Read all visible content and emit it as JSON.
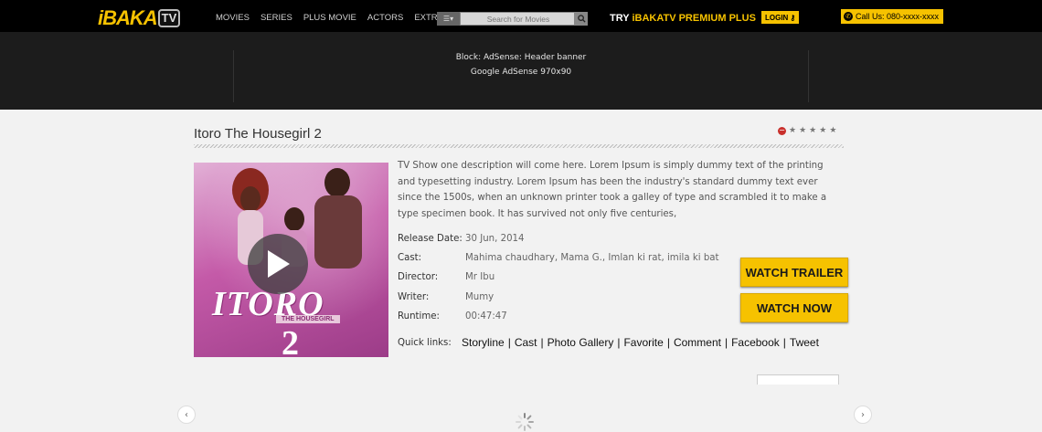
{
  "header": {
    "logo_text": "iBAKA",
    "logo_tv": "TV",
    "nav": [
      "MOVIES",
      "SERIES",
      "PLUS MOVIE",
      "ACTORS",
      "EXTRAS"
    ],
    "search_placeholder": "Search for Movies",
    "try_prefix": "TRY ",
    "try_brand": "iBAKATV PREMIUM PLUS",
    "login_label": "LOGIN",
    "call_label": "Call Us: 080-xxxx-xxxx"
  },
  "ad": {
    "line1": "Block: AdSense: Header banner",
    "line2": "Google AdSense 970x90"
  },
  "show": {
    "title": "Itoro The Housegirl 2",
    "rating_stars": 5,
    "description": "TV Show one description will come here. Lorem Ipsum is simply dummy text of the printing and typesetting industry. Lorem Ipsum has been the industry's standard dummy text ever since the 1500s, when an unknown printer took a galley of type and scrambled it to make a type specimen book. It has survived not only five centuries,",
    "poster": {
      "title_text": "ITORO",
      "subtitle_text": "THE HOUSEGIRL",
      "number_text": "2"
    },
    "meta": [
      {
        "label": "Release Date:",
        "value": "30 Jun, 2014"
      },
      {
        "label": "Cast:",
        "value": "Mahima chaudhary, Mama G., Imlan ki rat, imila ki bat"
      },
      {
        "label": "Director:",
        "value": "Mr Ibu"
      },
      {
        "label": "Writer:",
        "value": "Mumy"
      },
      {
        "label": "Runtime:",
        "value": "00:47:47"
      }
    ],
    "quick_label": "Quick links:",
    "quick_links": [
      "Storyline",
      "Cast",
      "Photo Gallery",
      "Favorite",
      "Comment",
      "Facebook",
      "Tweet"
    ],
    "buttons": {
      "trailer": "WATCH TRAILER",
      "watch": "WATCH NOW"
    }
  },
  "colors": {
    "accent": "#f6c200",
    "topbar": "#000000",
    "adband": "#1c1c1c",
    "page": "#f2f2f2"
  }
}
